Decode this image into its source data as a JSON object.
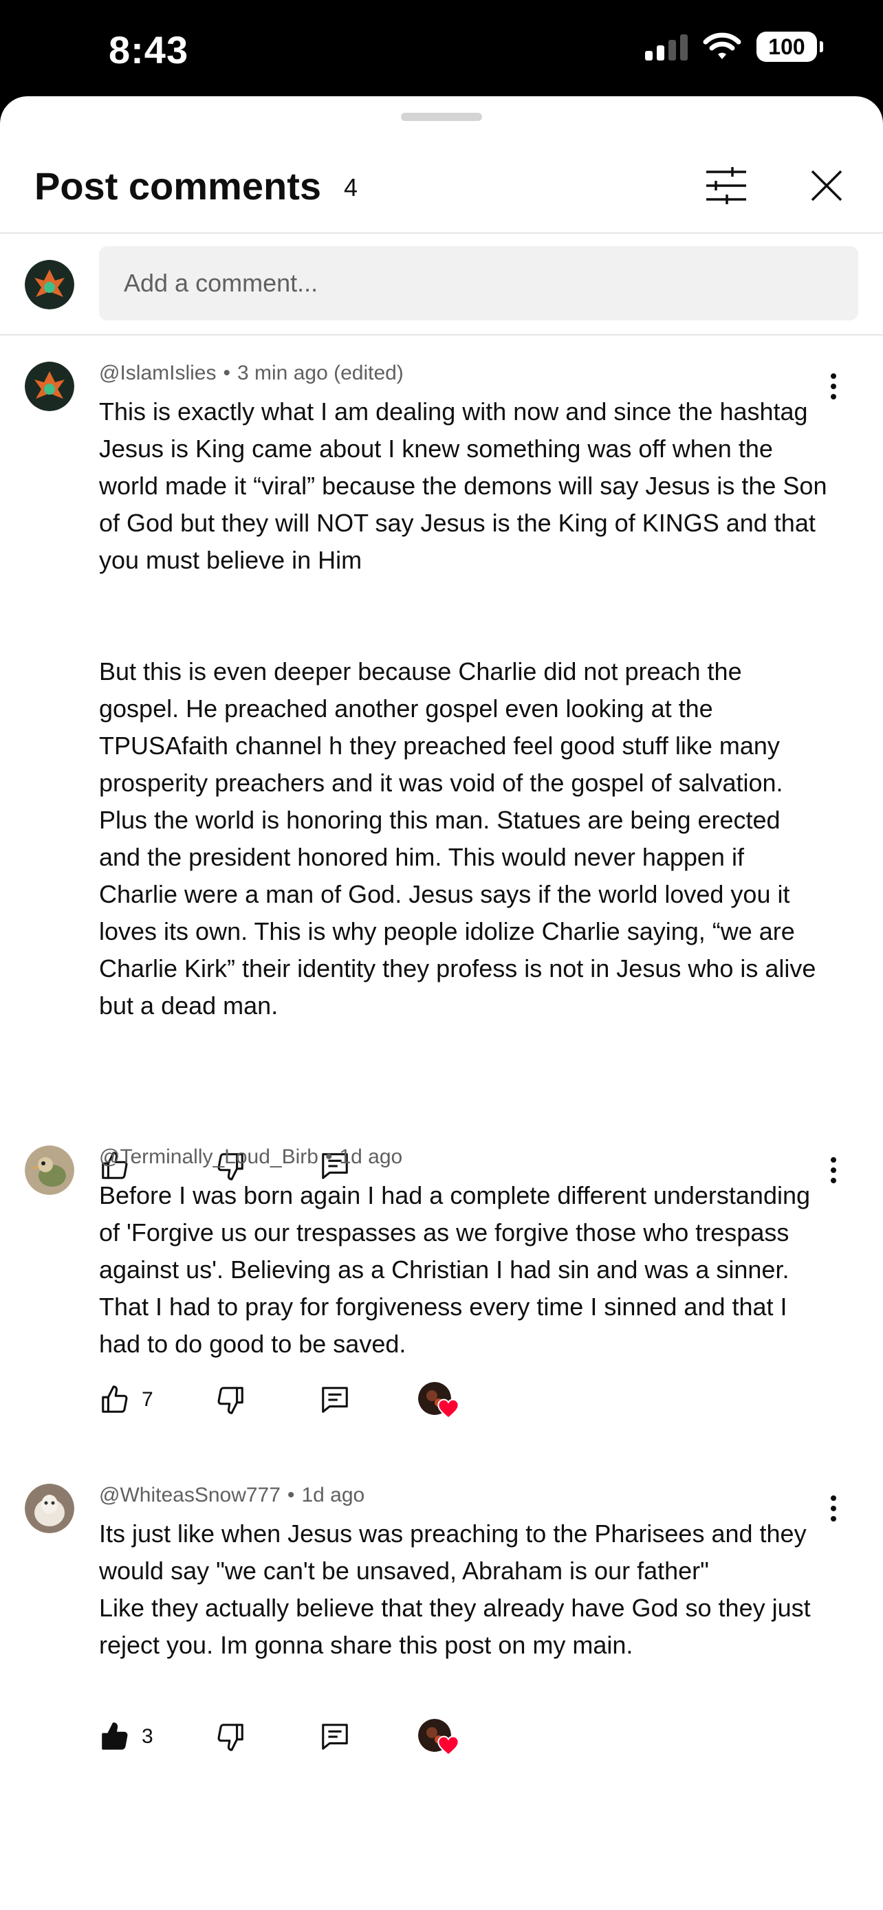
{
  "status_bar": {
    "time": "8:43",
    "battery": "100"
  },
  "header": {
    "title": "Post comments",
    "count": "4"
  },
  "add_comment": {
    "placeholder": "Add a comment..."
  },
  "comments": [
    {
      "author": "@IslamIslies",
      "age": "3 min ago (edited)",
      "text": "This is exactly what I am dealing with now and since the hashtag Jesus is King came about I knew something was off when the world made it “viral” because the demons will say Jesus is the Son of God but they will NOT say Jesus is the King of KINGS and that you must believe in Him\n\n\nBut this is even deeper because Charlie did not preach the gospel. He preached another gospel even looking at the TPUSAfaith channel h they preached feel good stuff like many prosperity preachers and it was void of the gospel of salvation. Plus the world is honoring this man. Statues are being erected and the president honored him. This would never happen if Charlie were a man of God. Jesus says if the world loved you it loves its own. This is why people idolize Charlie saying, “we are Charlie Kirk” their identity they profess is not in Jesus who is alive but a dead man.",
      "likes": "",
      "liked": false,
      "creator_heart": false
    },
    {
      "author": "@Terminally_Loud_Birb",
      "age": "1d ago",
      "text": "Before I was born again I had a complete different understanding of 'Forgive us our trespasses as we forgive those who trespass against us'.  Believing as a Christian I had sin and was a sinner.  That I had to pray for forgiveness every time I sinned and that I had to do good to be saved.",
      "likes": "7",
      "liked": false,
      "creator_heart": true
    },
    {
      "author": "@WhiteasSnow777",
      "age": "1d ago",
      "text": "Its just like when Jesus was preaching to the Pharisees and they would say \"we can't be unsaved, Abraham is our father\"\nLike they actually believe that they already have God so they just reject you. Im gonna share this post on my main.",
      "likes": "3",
      "liked": true,
      "creator_heart": true
    }
  ],
  "colors": {
    "heart": "#ff0033",
    "meta_text": "#606060",
    "input_bg": "#f1f1f1"
  }
}
